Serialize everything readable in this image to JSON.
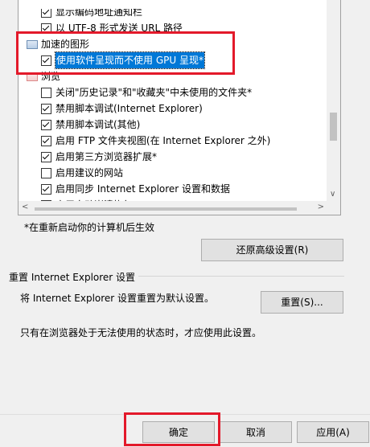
{
  "settings_list": {
    "items": [
      {
        "label": "显示编码地址通知栏",
        "checked": true
      },
      {
        "label": "以 UTF-8 形式发送 URL 路径",
        "checked": true
      },
      {
        "category": "加速的图形"
      },
      {
        "label": "使用软件呈现而不使用 GPU 呈现*",
        "checked": true,
        "selected": true
      },
      {
        "category": "浏览"
      },
      {
        "label": "关闭\"历史记录\"和\"收藏夹\"中未使用的文件夹*",
        "checked": false
      },
      {
        "label": "禁用脚本调试(Internet Explorer)",
        "checked": true
      },
      {
        "label": "禁用脚本调试(其他)",
        "checked": true
      },
      {
        "label": "启用 FTP 文件夹视图(在 Internet Explorer 之外)",
        "checked": true
      },
      {
        "label": "启用第三方浏览器扩展*",
        "checked": true
      },
      {
        "label": "启用建议的网站",
        "checked": false
      },
      {
        "label": "启用同步 Internet Explorer 设置和数据",
        "checked": true
      },
      {
        "label": "启用自动崩溃恢复*",
        "checked": true
      }
    ]
  },
  "restart_note": "*在重新启动你的计算机后生效",
  "restore_button": "还原高级设置(R)",
  "reset_section": {
    "title": "重置 Internet Explorer 设置",
    "description": "将 Internet Explorer 设置重置为默认设置。",
    "reset_button": "重置(S)...",
    "warning": "只有在浏览器处于无法使用的状态时，才应使用此设置。"
  },
  "footer": {
    "ok": "确定",
    "cancel": "取消",
    "apply": "应用(A)"
  },
  "colors": {
    "highlight": "#e3192a",
    "selection": "#0078d7"
  }
}
